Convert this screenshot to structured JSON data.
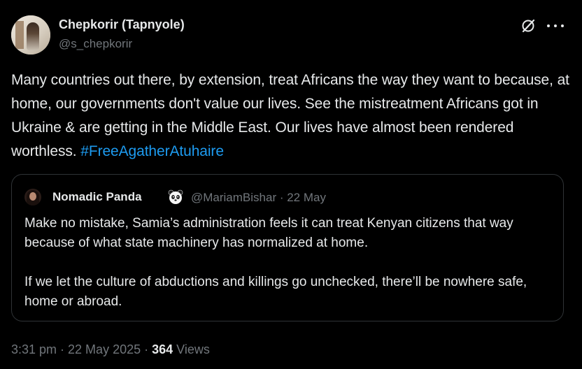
{
  "author": {
    "display_name": "Chepkorir (Tapnyole)",
    "handle": "@s_chepkorir"
  },
  "tweet": {
    "text": "Many countries out there, by extension, treat Africans the way they want to because, at home, our governments don't value our lives. See the mistreatment Africans got in Ukraine & are getting in the Middle East. Our lives have almost been rendered worthless. ",
    "hashtag": "#FreeAgatherAtuhaire"
  },
  "quoted": {
    "display_name": "Nomadic Panda",
    "badge_icon": "panda-emoji-icon",
    "meta": "@MariamBishar · 22 May",
    "paragraphs": [
      "Make no mistake, Samia’s administration feels it can treat Kenyan citizens that way because of what state machinery has normalized at home.",
      "If we let the culture of abductions and killings go unchecked, there’ll be nowhere safe, home or abroad."
    ]
  },
  "footer": {
    "timestamp": "3:31 pm · 22 May 2025 · ",
    "views_count": "364",
    "views_label": " Views"
  },
  "icons": {
    "grok": "grok-icon",
    "more": "more-options-icon"
  },
  "colors": {
    "background": "#000000",
    "text": "#e7e9ea",
    "secondary": "#71767b",
    "link": "#1d9bf0",
    "border": "#2f3336"
  }
}
